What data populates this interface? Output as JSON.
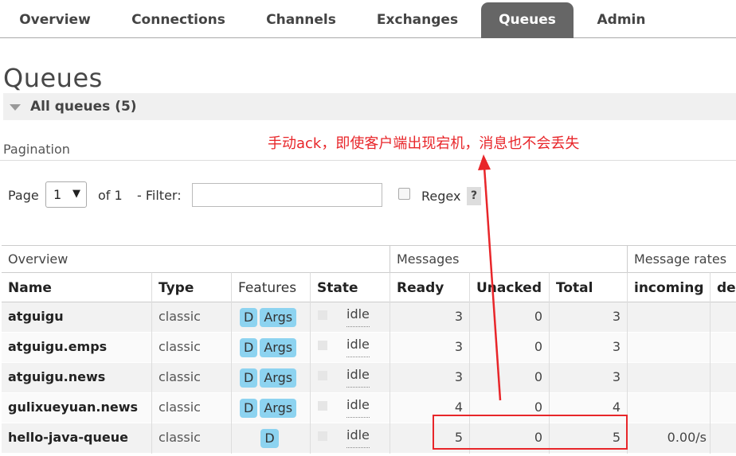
{
  "nav": {
    "tabs": [
      {
        "label": "Overview",
        "active": false
      },
      {
        "label": "Connections",
        "active": false
      },
      {
        "label": "Channels",
        "active": false
      },
      {
        "label": "Exchanges",
        "active": false
      },
      {
        "label": "Queues",
        "active": true
      },
      {
        "label": "Admin",
        "active": false
      }
    ]
  },
  "page_title": "Queues",
  "section": {
    "label": "All queues (5)",
    "icon": "triangle-down-icon"
  },
  "annotation": "手动ack，即使客户端出现宕机，消息也不会丢失",
  "pagination": {
    "label": "Pagination",
    "page_label": "Page",
    "page_value": "1",
    "of_label": "of 1",
    "filter_label": "- Filter:",
    "filter_value": "",
    "regex_label": "Regex",
    "help_label": "?"
  },
  "table": {
    "groups": [
      "Overview",
      "Messages",
      "Message rates"
    ],
    "headers": [
      "Name",
      "Type",
      "Features",
      "State",
      "Ready",
      "Unacked",
      "Total",
      "incoming",
      "de"
    ],
    "rows": [
      {
        "name": "atguigu",
        "type": "classic",
        "features": [
          "D",
          "Args"
        ],
        "state": "idle",
        "ready": "3",
        "unacked": "0",
        "total": "3",
        "incoming": ""
      },
      {
        "name": "atguigu.emps",
        "type": "classic",
        "features": [
          "D",
          "Args"
        ],
        "state": "idle",
        "ready": "3",
        "unacked": "0",
        "total": "3",
        "incoming": ""
      },
      {
        "name": "atguigu.news",
        "type": "classic",
        "features": [
          "D",
          "Args"
        ],
        "state": "idle",
        "ready": "3",
        "unacked": "0",
        "total": "3",
        "incoming": ""
      },
      {
        "name": "gulixueyuan.news",
        "type": "classic",
        "features": [
          "D",
          "Args"
        ],
        "state": "idle",
        "ready": "4",
        "unacked": "0",
        "total": "4",
        "incoming": ""
      },
      {
        "name": "hello-java-queue",
        "type": "classic",
        "features": [
          "D"
        ],
        "state": "idle",
        "ready": "5",
        "unacked": "0",
        "total": "5",
        "incoming": "0.00/s"
      }
    ]
  },
  "colors": {
    "accent_red": "#e8262a",
    "badge": "#8dd3f0",
    "active_tab": "#666666"
  }
}
